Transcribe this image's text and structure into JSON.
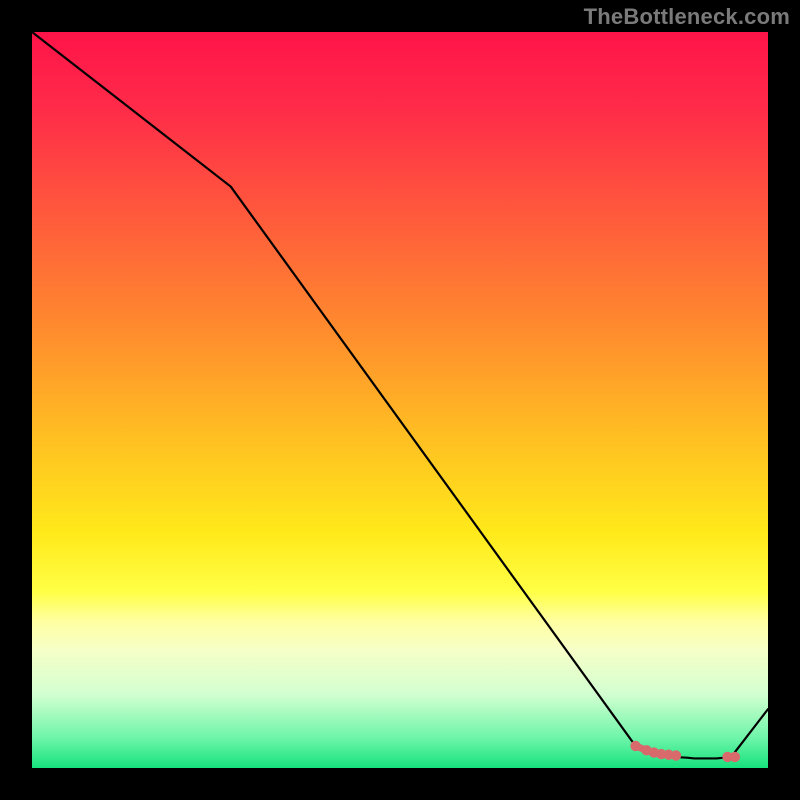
{
  "attribution": "TheBottleneck.com",
  "colors": {
    "background": "#000000",
    "line": "#000000",
    "marker_fill": "#d96a6c",
    "marker_stroke": "#d96a6c"
  },
  "chart_data": {
    "type": "line",
    "title": "",
    "xlabel": "",
    "ylabel": "",
    "x": [
      0.0,
      0.27,
      0.82,
      0.87,
      0.89,
      0.9,
      0.92,
      0.93,
      0.95,
      1.0
    ],
    "y": [
      1.0,
      0.79,
      0.03,
      0.015,
      0.014,
      0.013,
      0.013,
      0.013,
      0.015,
      0.08
    ],
    "xlim": [
      0,
      1
    ],
    "ylim": [
      0,
      1
    ],
    "gradient_stops": [
      {
        "pos": 0.0,
        "hex": "#ff1449"
      },
      {
        "pos": 0.1,
        "hex": "#ff2a49"
      },
      {
        "pos": 0.25,
        "hex": "#ff5a3c"
      },
      {
        "pos": 0.4,
        "hex": "#ff8a2e"
      },
      {
        "pos": 0.55,
        "hex": "#ffbf22"
      },
      {
        "pos": 0.68,
        "hex": "#ffe91a"
      },
      {
        "pos": 0.76,
        "hex": "#ffff45"
      },
      {
        "pos": 0.8,
        "hex": "#ffffa0"
      },
      {
        "pos": 0.84,
        "hex": "#f6ffc8"
      },
      {
        "pos": 0.9,
        "hex": "#d2ffd0"
      },
      {
        "pos": 0.96,
        "hex": "#6cf5a9"
      },
      {
        "pos": 1.0,
        "hex": "#16e27c"
      }
    ],
    "markers": {
      "x": [
        0.82,
        0.835,
        0.845,
        0.855,
        0.865,
        0.875,
        0.945,
        0.955
      ],
      "y": [
        0.03,
        0.024,
        0.021,
        0.019,
        0.018,
        0.017,
        0.015,
        0.015
      ]
    },
    "marker_segment": {
      "x": [
        0.82,
        0.835,
        0.845,
        0.855,
        0.865,
        0.875
      ],
      "y": [
        0.03,
        0.024,
        0.021,
        0.019,
        0.018,
        0.017
      ]
    }
  }
}
